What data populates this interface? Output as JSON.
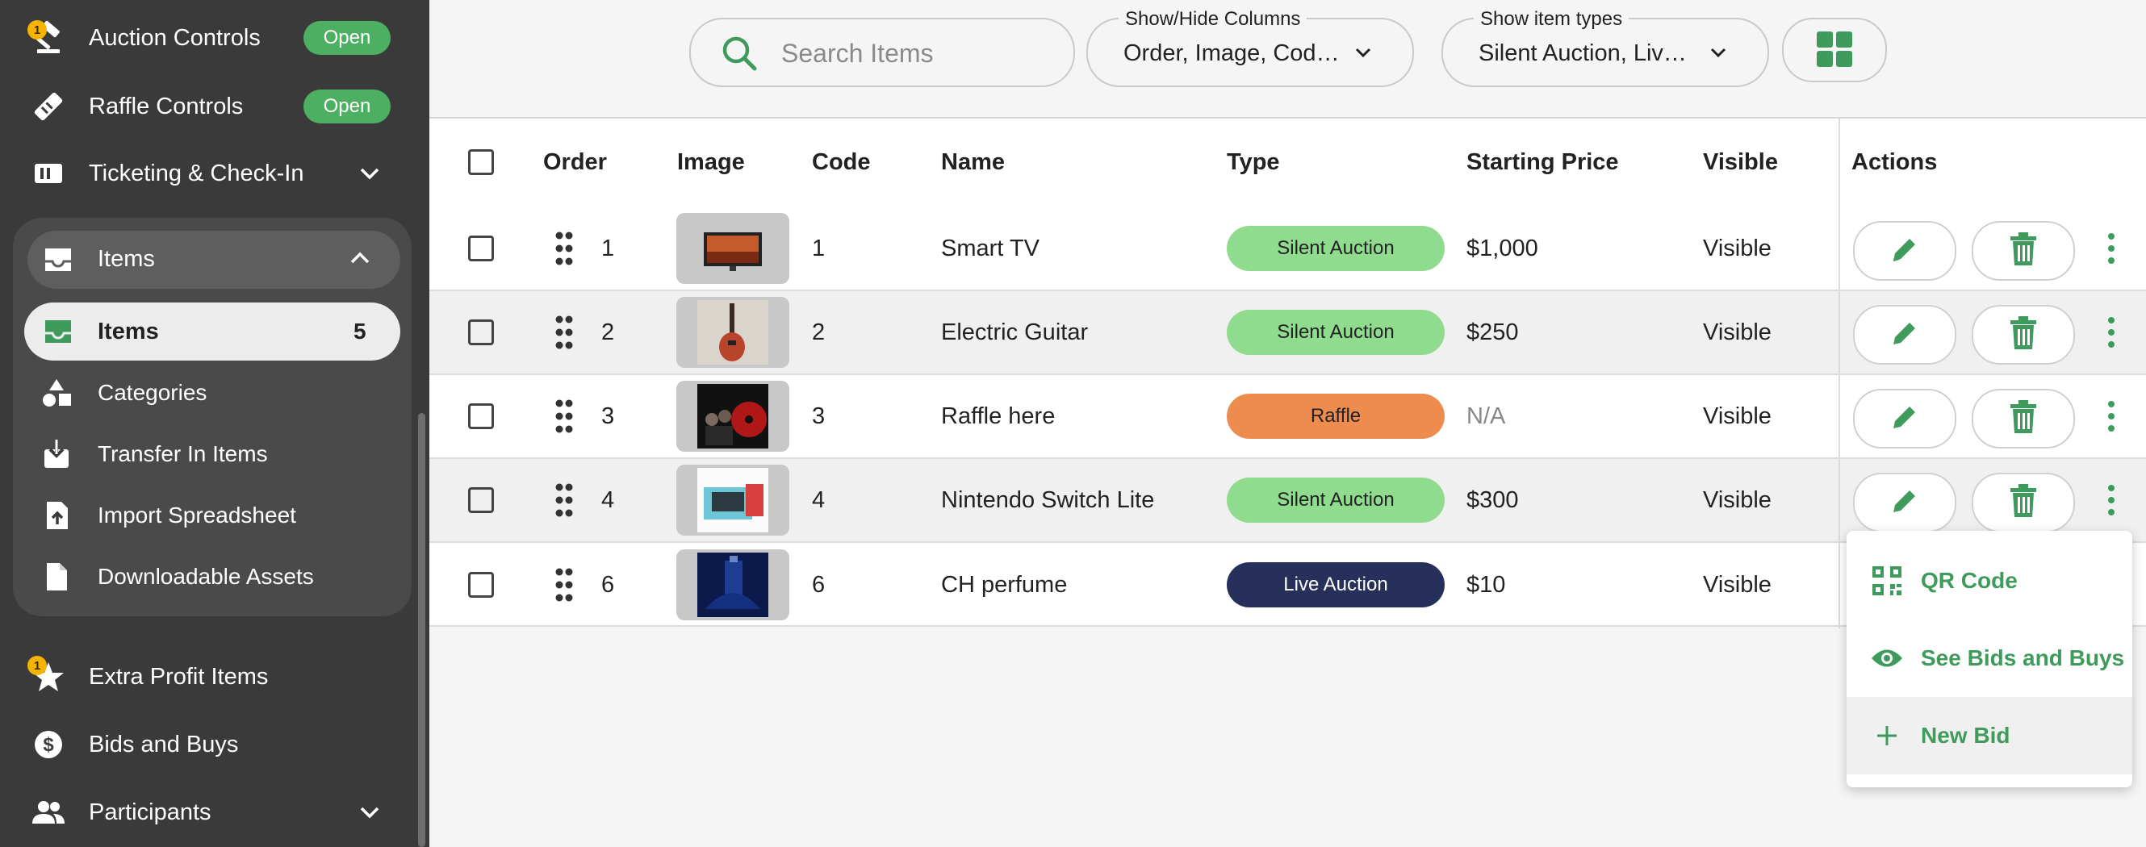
{
  "sidebar": {
    "top_items": [
      {
        "label": "Auction Controls",
        "badge": "1",
        "status": "Open",
        "icon": "gavel-icon"
      },
      {
        "label": "Raffle Controls",
        "status": "Open",
        "icon": "ticket-icon"
      },
      {
        "label": "Ticketing & Check-In",
        "icon": "ticket-stack-icon"
      }
    ],
    "items_group": {
      "header": "Items",
      "active": {
        "label": "Items",
        "count": "5"
      },
      "sub_items": [
        {
          "label": "Categories",
          "icon": "shapes-icon"
        },
        {
          "label": "Transfer In Items",
          "icon": "transfer-in-icon"
        },
        {
          "label": "Import Spreadsheet",
          "icon": "file-upload-icon"
        },
        {
          "label": "Downloadable Assets",
          "icon": "file-icon"
        }
      ]
    },
    "bottom_items": [
      {
        "label": "Extra Profit Items",
        "badge": "1",
        "icon": "star-icon"
      },
      {
        "label": "Bids and Buys",
        "icon": "dollar-icon"
      },
      {
        "label": "Participants",
        "icon": "people-icon"
      }
    ]
  },
  "toolbar": {
    "search_placeholder": "Search Items",
    "columns_select": {
      "label": "Show/Hide Columns",
      "value": "Order, Image, Code, ..."
    },
    "types_select": {
      "label": "Show item types",
      "value": "Silent Auction, Live ..."
    }
  },
  "table": {
    "headers": {
      "order": "Order",
      "image": "Image",
      "code": "Code",
      "name": "Name",
      "type": "Type",
      "price": "Starting Price",
      "visible": "Visible",
      "actions": "Actions"
    },
    "rows": [
      {
        "order": "1",
        "code": "1",
        "name": "Smart TV",
        "type": "Silent Auction",
        "price": "$1,000",
        "visible": "Visible"
      },
      {
        "order": "2",
        "code": "2",
        "name": "Electric Guitar",
        "type": "Silent Auction",
        "price": "$250",
        "visible": "Visible"
      },
      {
        "order": "3",
        "code": "3",
        "name": "Raffle here",
        "type": "Raffle",
        "price": "N/A",
        "visible": "Visible"
      },
      {
        "order": "4",
        "code": "4",
        "name": "Nintendo Switch Lite",
        "type": "Silent Auction",
        "price": "$300",
        "visible": "Visible"
      },
      {
        "order": "6",
        "code": "6",
        "name": "CH perfume",
        "type": "Live Auction",
        "price": "$10",
        "visible": "Visible"
      }
    ]
  },
  "row_menu": {
    "items": [
      {
        "label": "QR Code",
        "icon": "qr-code-icon"
      },
      {
        "label": "See Bids and Buys",
        "icon": "eye-icon"
      },
      {
        "label": "New Bid",
        "icon": "plus-icon"
      }
    ]
  },
  "colors": {
    "sidebar_bg": "#3a3a3a",
    "open_pill": "#4caf62",
    "silent_auction": "#8fdc8f",
    "raffle": "#ee8c4f",
    "live_auction": "#26305a",
    "accent_green": "#3f9b5b"
  }
}
